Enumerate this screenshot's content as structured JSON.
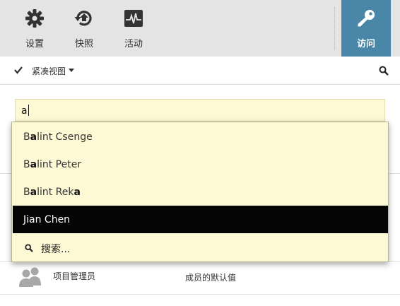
{
  "toolbar": {
    "settings": {
      "label": "设置",
      "icon": "gear-icon"
    },
    "snapshot": {
      "label": "快照",
      "icon": "snapshot-history-icon"
    },
    "activity": {
      "label": "活动",
      "icon": "activity-pulse-icon"
    },
    "access": {
      "label": "访问",
      "icon": "key-icon",
      "accent": "#4a86a8"
    }
  },
  "viewbar": {
    "view_label": "紧凑视图",
    "check_icon": "check-icon",
    "search_icon": "search-icon"
  },
  "search": {
    "value": "a"
  },
  "dropdown": {
    "items": [
      {
        "prefix": "B",
        "match": "a",
        "suffix": "lint Csenge",
        "selected": false
      },
      {
        "prefix": "B",
        "match": "a",
        "suffix": "lint Peter",
        "selected": false
      },
      {
        "prefix": "B",
        "match": "a",
        "suffix": "lint Rek",
        "trail": "a",
        "selected": false
      },
      {
        "prefix": "Jian Chen",
        "match": "",
        "suffix": "",
        "selected": true
      }
    ],
    "search_label": "搜索..."
  },
  "member_row": {
    "role": "项目管理员",
    "default": "成员的默认值",
    "icon": "group-icon"
  }
}
